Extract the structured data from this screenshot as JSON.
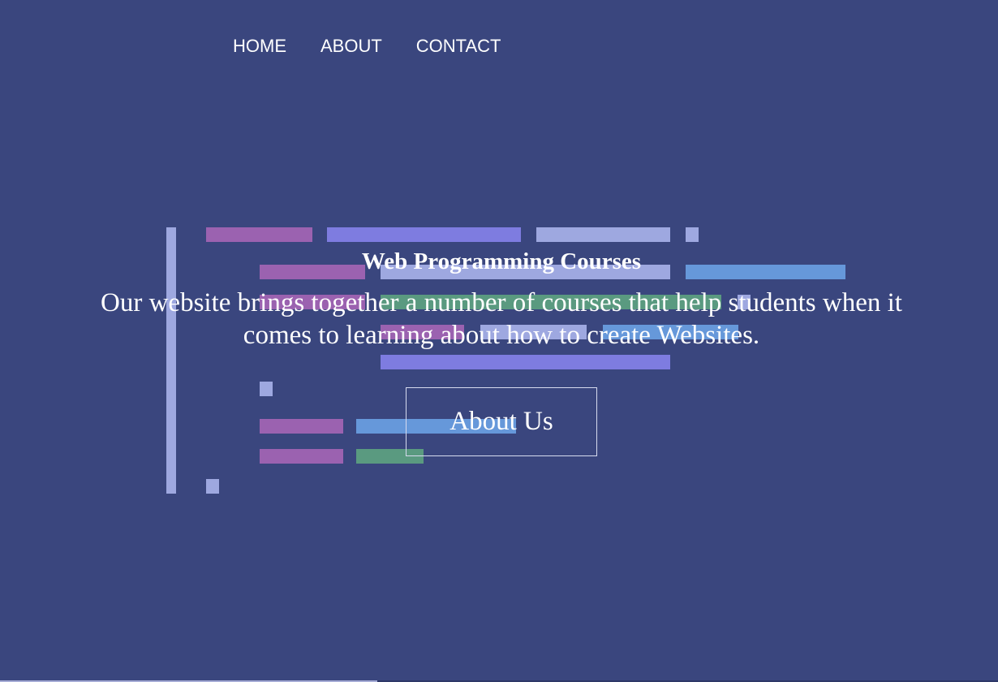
{
  "nav": {
    "items": [
      "HOME",
      "ABOUT",
      "CONTACT"
    ]
  },
  "hero": {
    "title": "Web Programming Courses",
    "description": "Our website brings together a number of courses that help students when it comes to learning about how to create Websites.",
    "button_label": "About Us"
  },
  "colors": {
    "background": "#3a467e",
    "purple": "#9b62b0",
    "indigo": "#7e7ce0",
    "lavender": "#9ea8e0",
    "blue": "#6698da",
    "green": "#5a9a80"
  },
  "decor": {
    "image": "code-lines-illustration"
  }
}
